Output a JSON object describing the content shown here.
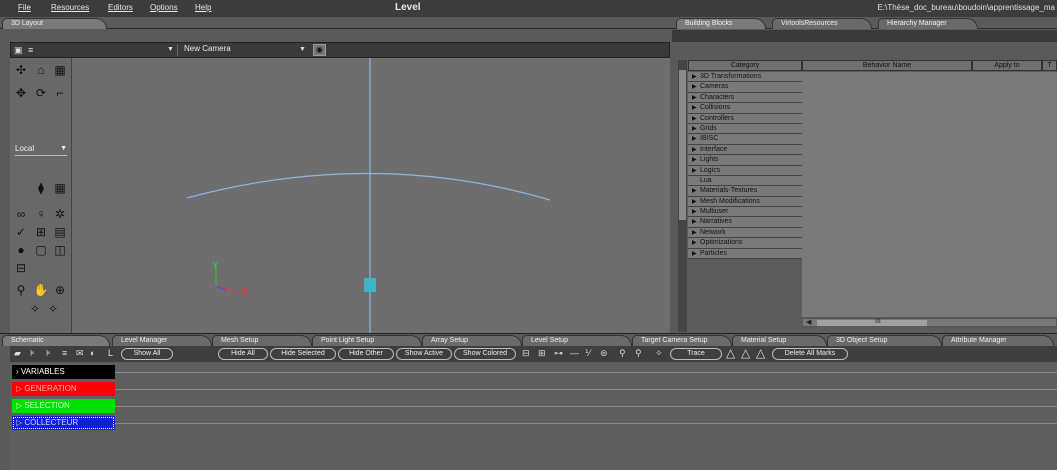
{
  "menu": {
    "items": [
      "File",
      "Resources",
      "Editors",
      "Options",
      "Help"
    ],
    "title": "Level",
    "path": "E:\\Thèse_doc_bureau\\boudoin\\apprentissage_ma"
  },
  "left_tabs": {
    "layout": "3D Layout"
  },
  "right_tabs": [
    "Building Blocks",
    "VirtoolsResources",
    "Hierarchy Manager"
  ],
  "view": {
    "camera": "New Camera",
    "coord_mode": "Local",
    "axis_x": "X",
    "axis_y": "Y"
  },
  "building_blocks": {
    "columns": [
      "Category",
      "Behavior Name",
      "Apply to",
      "T"
    ],
    "categories": [
      "3D Transformations",
      "Cameras",
      "Characters",
      "Collisions",
      "Controllers",
      "Grids",
      "IBISC",
      "Interface",
      "Lights",
      "Logics",
      "Lua",
      "Materials-Textures",
      "Mesh Modifications",
      "Multiuser",
      "Narratives",
      "Network",
      "Optimizations",
      "Particles"
    ],
    "hscroll_label": "III"
  },
  "bottom_tabs": [
    "Schematic",
    "Level Manager",
    "Mesh Setup",
    "Point Light Setup",
    "Array Setup",
    "Level Setup",
    "Target Camera Setup",
    "Material Setup",
    "3D Object Setup",
    "Attribute Manager"
  ],
  "schematic_toolbar": {
    "l_label": "L",
    "show_all": "Show All",
    "hide_all": "Hide All",
    "hide_selected": "Hide Selected",
    "hide_other": "Hide Other",
    "show_active": "Show Active",
    "show_colored": "Show Colored",
    "trace": "Trace",
    "delete_all_marks": "Delete All Marks"
  },
  "scripts": {
    "variables": "VARIABLES",
    "generation": "GENERATION",
    "selection": "SELECTION",
    "collecteur": "COLLECTEUR"
  },
  "colors": {
    "generation": "#ff0000",
    "selection": "#00e000",
    "collecteur": "#1020d8",
    "variables": "#000000"
  }
}
